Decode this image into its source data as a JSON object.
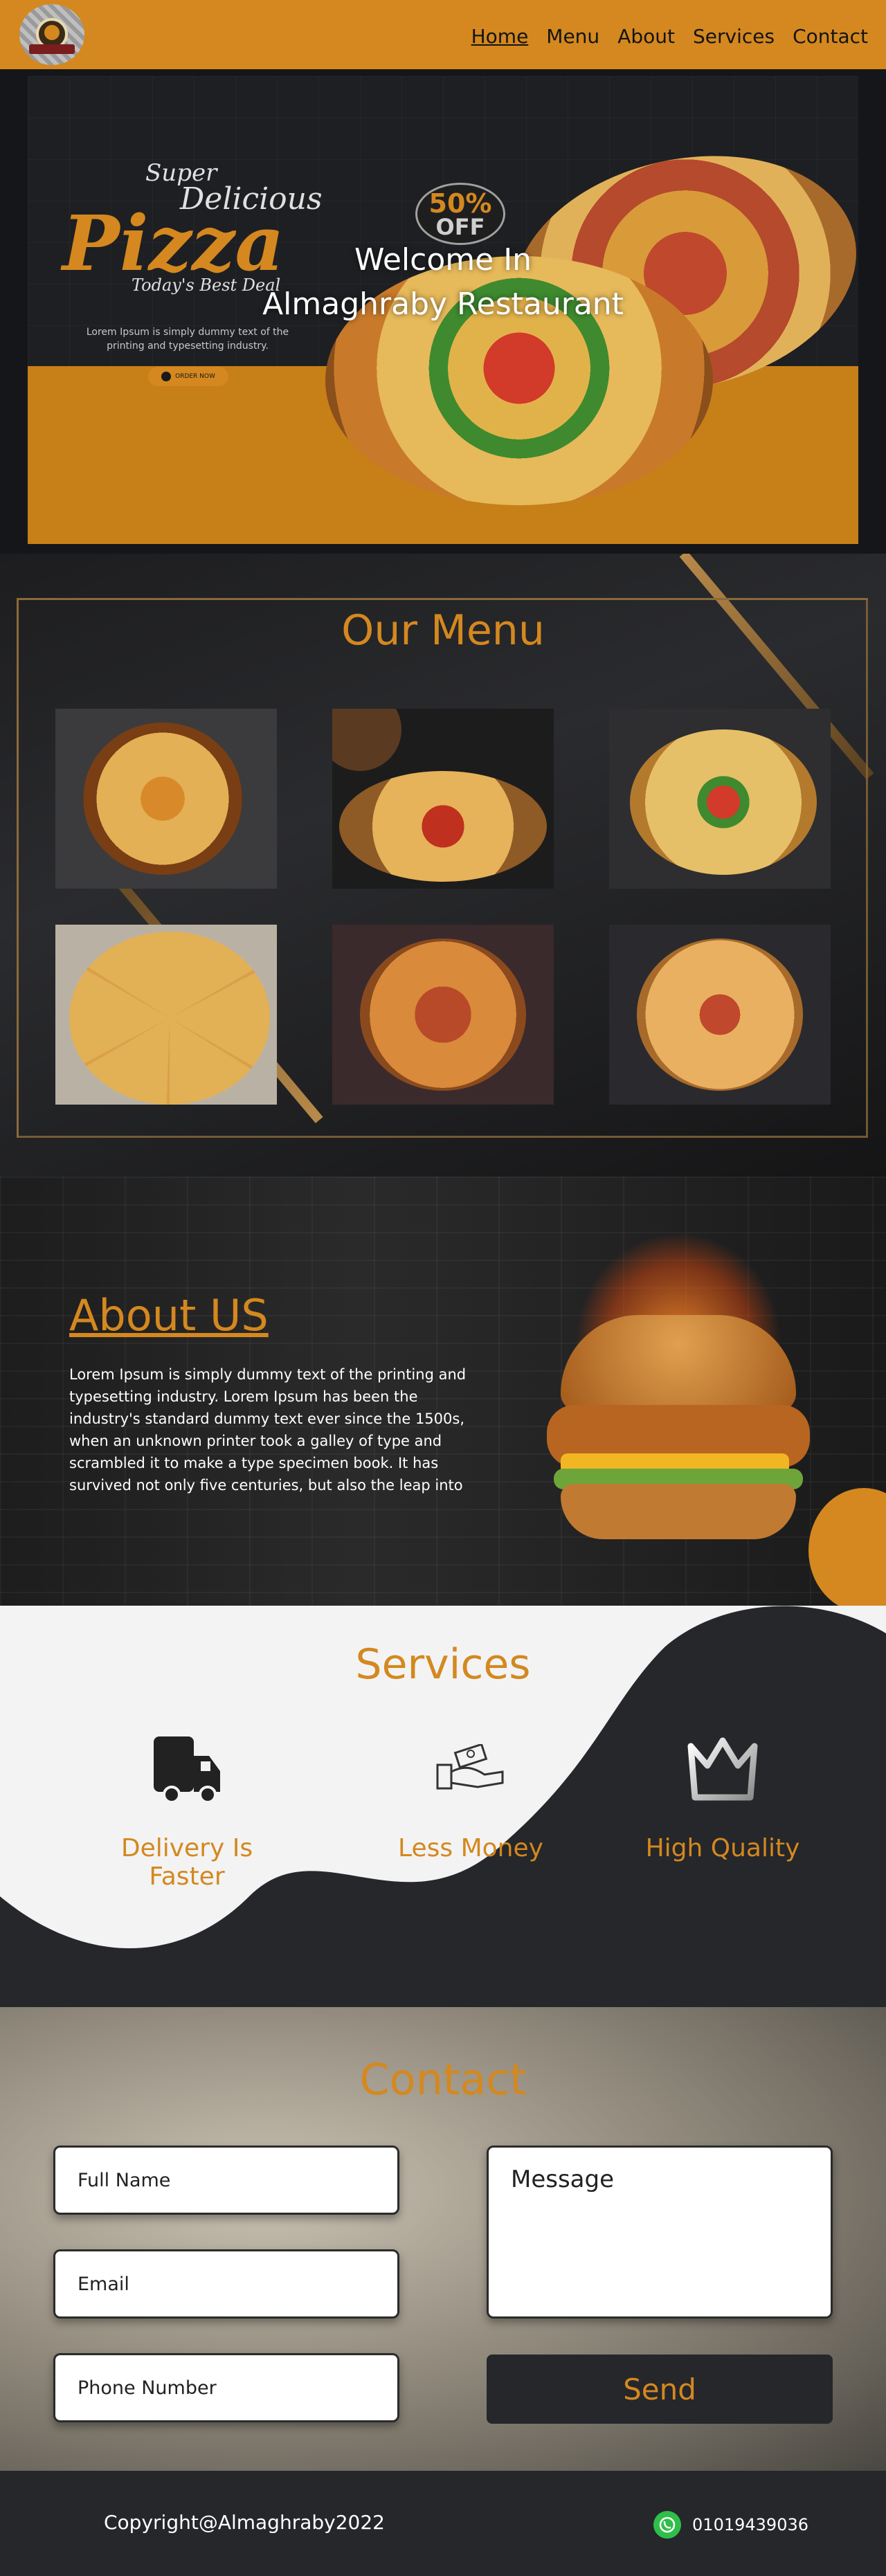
{
  "nav": {
    "links": [
      {
        "label": "Home",
        "active": true
      },
      {
        "label": "Menu"
      },
      {
        "label": "About"
      },
      {
        "label": "Services"
      },
      {
        "label": "Contact"
      }
    ],
    "bg_color": "#d4881f"
  },
  "hero": {
    "welcome_line1": "Welcome In",
    "welcome_line2": "Almaghraby Restaurant",
    "banner": {
      "script_super": "Super",
      "script_delicious": "Delicious",
      "script_pizza": "Pizza",
      "script_tagline": "Today's Best Deal",
      "lorem": "Lorem Ipsum is simply dummy text of the printing and typesetting industry.",
      "order_button": "ORDER NOW",
      "discount_value": "50%",
      "discount_label": "OFF"
    }
  },
  "menu": {
    "title": "Our Menu",
    "items": [
      {
        "icon": "pizza-photo"
      },
      {
        "icon": "pizza-slice-photo"
      },
      {
        "icon": "pizza-photo"
      },
      {
        "icon": "sliced-pizza-photo"
      },
      {
        "icon": "pizza-photo"
      },
      {
        "icon": "pizza-photo"
      }
    ]
  },
  "about": {
    "title": "About US",
    "text": "Lorem Ipsum is simply dummy text of the printing and typesetting industry. Lorem Ipsum has been the industry's standard dummy text ever since the 1500s, when an unknown printer took a galley of type and scrambled it to make a type specimen book. It has survived not only five centuries, but also the leap into"
  },
  "services": {
    "title": "Services",
    "items": [
      {
        "label": "Delivery Is Faster",
        "icon": "truck-icon"
      },
      {
        "label": "Less Money",
        "icon": "money-hand-icon"
      },
      {
        "label": "High Quality",
        "icon": "crown-icon"
      }
    ]
  },
  "contact": {
    "title": "Contact",
    "full_name_placeholder": "Full Name",
    "email_placeholder": "Email",
    "phone_placeholder": "Phone Number",
    "message_placeholder": "Message",
    "send_label": "Send"
  },
  "footer": {
    "copyright": "Copyright@Almaghraby2022",
    "phone": "01019439036",
    "phone_icon": "whatsapp-icon"
  },
  "colors": {
    "accent": "#d4881f",
    "dark": "#25272b"
  }
}
